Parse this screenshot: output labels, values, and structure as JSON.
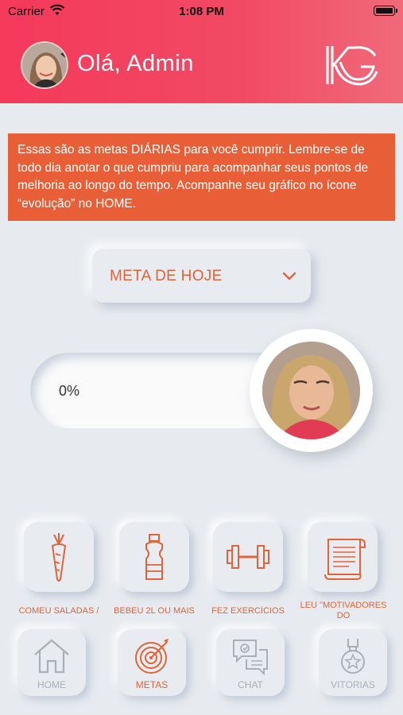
{
  "status_bar": {
    "carrier": "Carrier",
    "time": "1:08 PM"
  },
  "header": {
    "greeting": "Olá, Admin",
    "logo": "kg-logo",
    "background_color": "#f5395b"
  },
  "info_box": {
    "text": "Essas são as metas DIÁRIAS para você cumprir. Lembre-se de todo dia anotar o que cumpriu para acompanhar seus pontos de melhoria ao longo do tempo. Acompanhe seu gráfico no ícone “evolução” no HOME.",
    "background_color": "#e85f37"
  },
  "goal_selector": {
    "selected": "META DE HOJE",
    "icon": "chevron-down-icon"
  },
  "progress": {
    "label": "0%",
    "value": 0
  },
  "goals": [
    {
      "label": "COMEU SALADAS /",
      "icon": "carrot-icon"
    },
    {
      "label": "BEBEU 2L OU MAIS",
      "icon": "water-bottle-icon"
    },
    {
      "label": "FEZ EXERCÍCIOS",
      "icon": "dumbbell-icon"
    },
    {
      "label": "LEU \"MOTIVADORES DO",
      "icon": "scroll-icon"
    }
  ],
  "tabs": [
    {
      "label": "HOME",
      "icon": "home-icon",
      "active": false
    },
    {
      "label": "METAS",
      "icon": "target-icon",
      "active": true
    },
    {
      "label": "CHAT",
      "icon": "chat-icon",
      "active": false
    },
    {
      "label": "VITORIAS",
      "icon": "medal-icon",
      "active": false
    }
  ],
  "accent_color": "#e0633a",
  "inactive_color": "#a9b0b8"
}
